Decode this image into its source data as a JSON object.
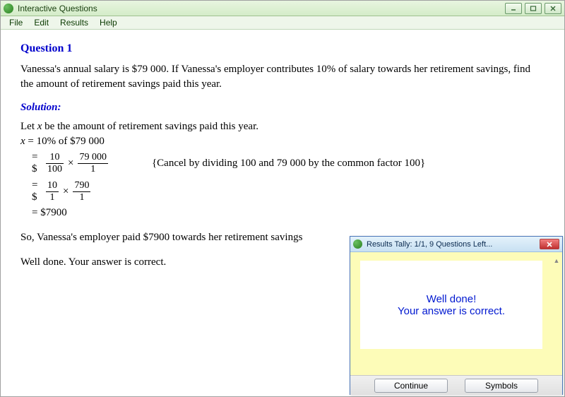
{
  "window": {
    "title": "Interactive Questions"
  },
  "menubar": {
    "file": "File",
    "edit": "Edit",
    "results": "Results",
    "help": "Help"
  },
  "question": {
    "title": "Question 1",
    "text": "Vanessa's annual salary is $79 000.  If Vanessa's employer contributes 10% of salary towards her retirement savings, find the amount of retirement savings paid this year."
  },
  "solution": {
    "title": "Solution:",
    "let_line_prefix": "Let ",
    "let_line_var": "x",
    "let_line_rest": " be the amount of retirement savings paid this year.",
    "line1_prefix": "x",
    "line1_rest": " = 10% of $79 000",
    "step2": {
      "prefix": "= $",
      "f1_num": "10",
      "f1_den": "100",
      "times": "×",
      "f2_num": "79 000",
      "f2_den": "1",
      "annot": "{Cancel by dividing 100 and 79 000 by the common factor 100}"
    },
    "step3": {
      "prefix": "= $",
      "f1_num": "10",
      "f1_den": "1",
      "times": "×",
      "f2_num": "790",
      "f2_den": "1"
    },
    "result": "= $7900",
    "so_line": "So, Vanessa's employer paid $7900 towards her retirement savings",
    "well_done": "Well done.  Your answer is correct."
  },
  "popup": {
    "title": "Results Tally:  1/1, 9 Questions Left...",
    "feedback_line1": "Well done!",
    "feedback_line2": "Your answer is correct.",
    "continue_label": "Continue",
    "symbols_label": "Symbols"
  }
}
